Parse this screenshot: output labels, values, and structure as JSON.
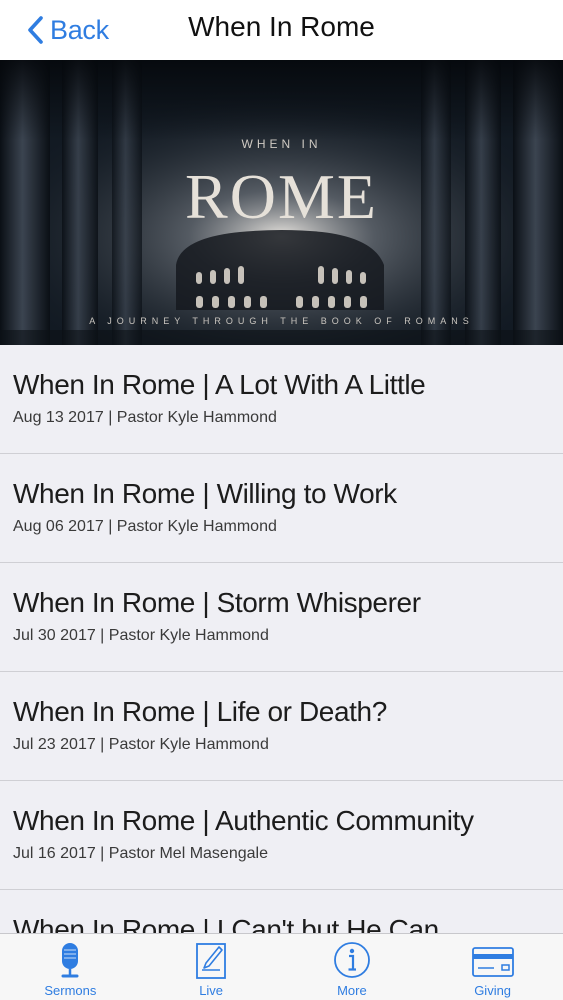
{
  "nav": {
    "back_label": "Back",
    "title": "When In Rome"
  },
  "banner": {
    "kicker": "WHEN IN",
    "title": "ROME",
    "subtitle": "A JOURNEY THROUGH THE BOOK OF ROMANS"
  },
  "sermons": [
    {
      "title": "When In Rome | A Lot With A Little",
      "meta": "Aug 13 2017 | Pastor Kyle Hammond"
    },
    {
      "title": "When In Rome | Willing to Work",
      "meta": "Aug 06 2017 | Pastor Kyle Hammond"
    },
    {
      "title": "When In Rome | Storm Whisperer",
      "meta": "Jul 30 2017 | Pastor Kyle Hammond"
    },
    {
      "title": "When In Rome | Life or Death?",
      "meta": "Jul 23 2017 | Pastor Kyle Hammond"
    },
    {
      "title": "When In Rome | Authentic Community",
      "meta": "Jul 16 2017 | Pastor Mel Masengale"
    },
    {
      "title": "When In Rome | I Can't but He Can",
      "meta": ""
    }
  ],
  "tabs": [
    {
      "label": "Sermons",
      "icon": "microphone-icon"
    },
    {
      "label": "Live",
      "icon": "notepad-icon"
    },
    {
      "label": "More",
      "icon": "info-icon"
    },
    {
      "label": "Giving",
      "icon": "credit-card-icon"
    }
  ],
  "colors": {
    "accent": "#2f7de1",
    "list_background": "#efeff4",
    "banner_background": "#0e141b"
  }
}
